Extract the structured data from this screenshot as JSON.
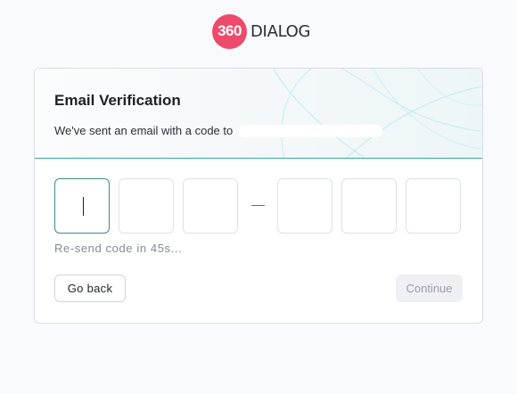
{
  "brand": {
    "logo_number": "360",
    "logo_word": "DIALOG",
    "logo_color": "#ee4a6b"
  },
  "card": {
    "title": "Email Verification",
    "subtitle": "We've sent an email with a code to",
    "email_redacted": true,
    "accent_color": "#3aa79d"
  },
  "code_inputs": {
    "values": [
      "",
      "",
      "",
      "",
      "",
      ""
    ],
    "separator": "—",
    "active_index": 0
  },
  "resend": {
    "text": "Re-send code in 45s..."
  },
  "actions": {
    "back_label": "Go back",
    "continue_label": "Continue",
    "continue_disabled": true
  }
}
